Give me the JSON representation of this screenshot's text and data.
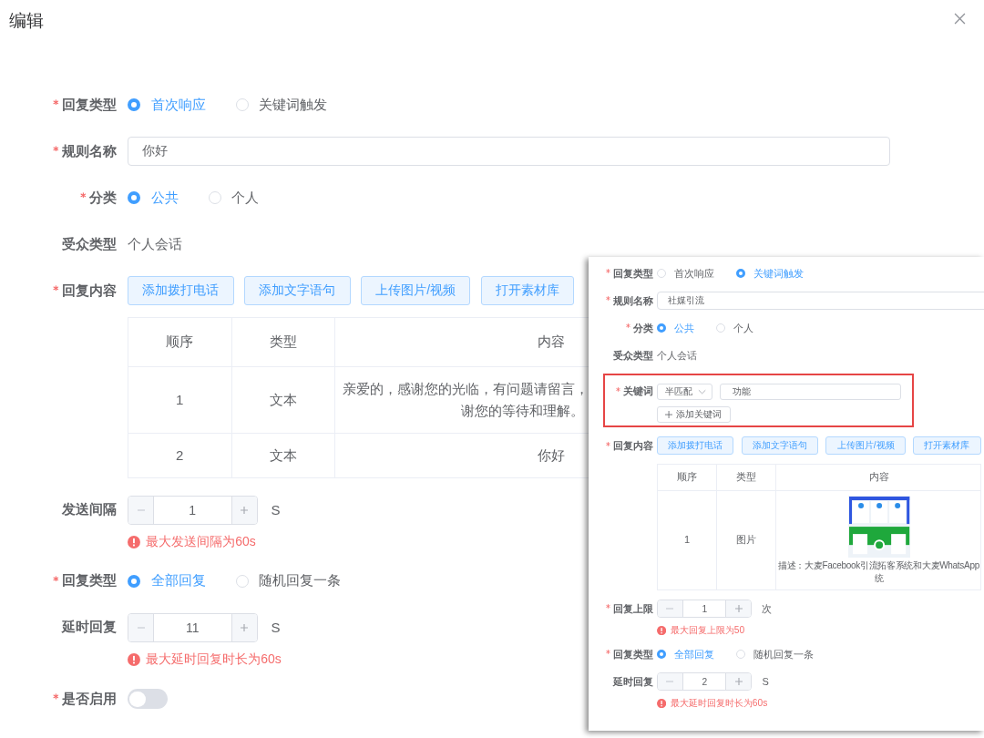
{
  "dialog": {
    "title": "编辑"
  },
  "form": {
    "fields": [
      {
        "kind": "radio",
        "label": "回复类型",
        "required": true,
        "options": [
          {
            "label": "首次响应",
            "selected": true
          },
          {
            "label": "关键词触发",
            "selected": false
          }
        ]
      },
      {
        "kind": "input",
        "label": "规则名称",
        "required": true,
        "value": "你好"
      },
      {
        "kind": "radio",
        "label": "分类",
        "required": true,
        "options": [
          {
            "label": "公共",
            "selected": true
          },
          {
            "label": "个人",
            "selected": false
          }
        ]
      },
      {
        "kind": "text",
        "label": "受众类型",
        "required": false,
        "value": "个人会话"
      },
      {
        "kind": "content",
        "label": "回复内容",
        "required": true,
        "buttons": [
          "添加拨打电话",
          "添加文字语句",
          "上传图片/视频",
          "打开素材库"
        ],
        "table": {
          "columns": [
            "顺序",
            "类型",
            "内容"
          ],
          "rows": [
            {
              "order": "1",
              "type": "文本",
              "content": {
                "kind": "text",
                "lines": [
                  "亲爱的，感谢您的光临，有问题请留言，",
                  "谢您的等待和理解。"
                ]
              }
            },
            {
              "order": "2",
              "type": "文本",
              "content": {
                "kind": "text",
                "lines": [
                  "你好"
                ]
              }
            }
          ]
        }
      },
      {
        "kind": "stepper",
        "label": "发送间隔",
        "required": false,
        "value": "1",
        "unit": "S",
        "error": "最大发送间隔为60s"
      },
      {
        "kind": "radio",
        "label": "回复类型",
        "required": true,
        "options": [
          {
            "label": "全部回复",
            "selected": true
          },
          {
            "label": "随机回复一条",
            "selected": false
          }
        ]
      },
      {
        "kind": "stepper",
        "label": "延时回复",
        "required": false,
        "value": "11",
        "unit": "S",
        "error": "最大延时回复时长为60s"
      },
      {
        "kind": "switch",
        "label": "是否启用",
        "required": true,
        "on": false
      }
    ]
  },
  "inset_screenshot": {
    "fields": [
      {
        "kind": "radio",
        "label": "回复类型",
        "required": true,
        "options": [
          {
            "label": "首次响应",
            "selected": false
          },
          {
            "label": "关键词触发",
            "selected": true
          }
        ]
      },
      {
        "kind": "input",
        "label": "规则名称",
        "required": true,
        "value": "社媒引流"
      },
      {
        "kind": "radio",
        "label": "分类",
        "required": true,
        "options": [
          {
            "label": "公共",
            "selected": true
          },
          {
            "label": "个人",
            "selected": false
          }
        ]
      },
      {
        "kind": "text",
        "label": "受众类型",
        "required": false,
        "value": "个人会话"
      },
      {
        "kind": "keyword",
        "label": "关键词",
        "required": true,
        "highlighted": true,
        "match": "半匹配",
        "value": "功能",
        "add_button": "添加关键词"
      },
      {
        "kind": "content",
        "label": "回复内容",
        "required": true,
        "buttons": [
          "添加拨打电话",
          "添加文字语句",
          "上传图片/视频",
          "打开素材库"
        ],
        "table": {
          "columns": [
            "顺序",
            "类型",
            "内容"
          ],
          "rows": [
            {
              "order": "1",
              "type": "图片",
              "content": {
                "kind": "picture",
                "lines": [
                  "描述：大麦Facebook引流拓客系统和大麦WhatsApp",
                  "统"
                ]
              }
            }
          ]
        }
      },
      {
        "kind": "stepper",
        "label": "回复上限",
        "required": true,
        "value": "1",
        "unit": "次",
        "error": "最大回复上限为50"
      },
      {
        "kind": "radio",
        "label": "回复类型",
        "required": true,
        "options": [
          {
            "label": "全部回复",
            "selected": true
          },
          {
            "label": "随机回复一条",
            "selected": false
          }
        ]
      },
      {
        "kind": "stepper",
        "label": "延时回复",
        "required": false,
        "value": "2",
        "unit": "S",
        "error": "最大延时回复时长为60s"
      }
    ]
  }
}
